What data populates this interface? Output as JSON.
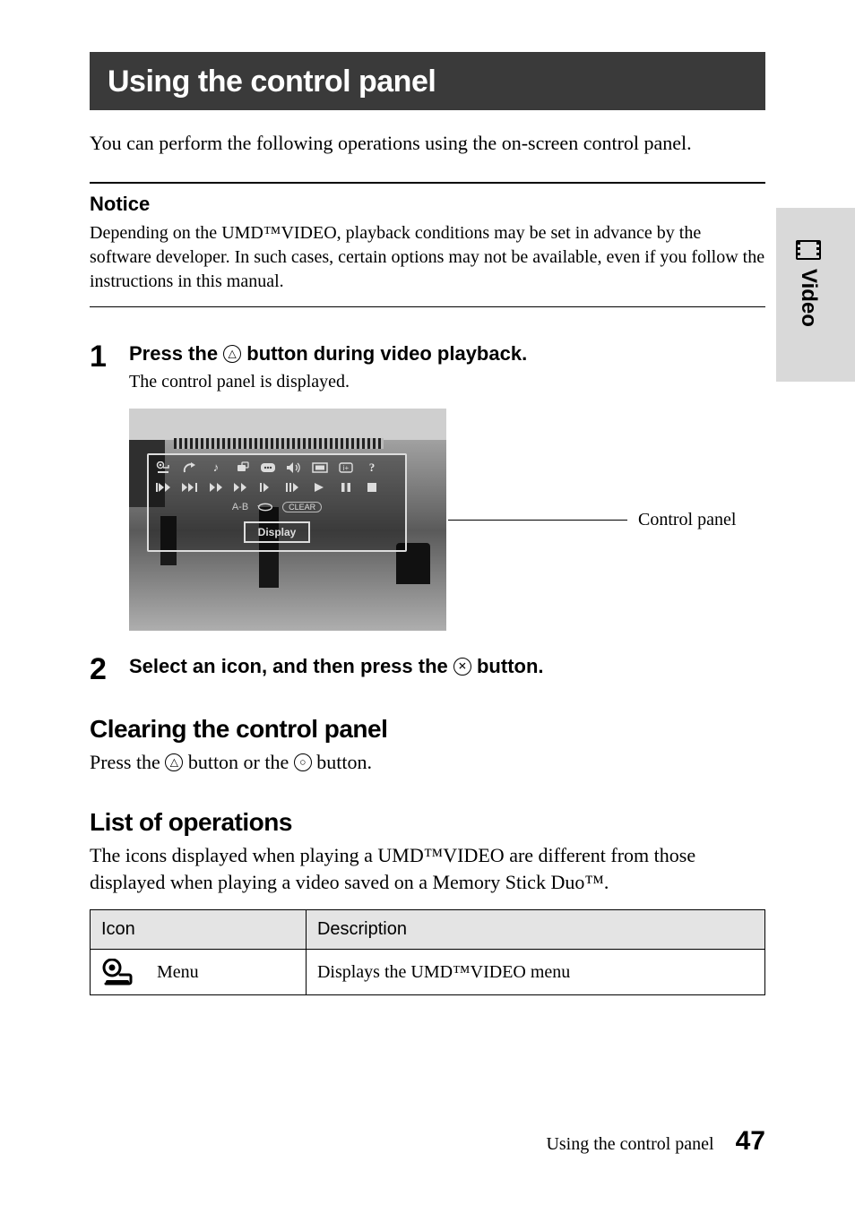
{
  "title_bar": "Using the control panel",
  "intro": "You can perform the following operations using the on-screen control panel.",
  "notice": {
    "heading": "Notice",
    "body": "Depending on the UMD™VIDEO, playback conditions may be set in advance by the software developer. In such cases, certain options may not be available, even if you follow the instructions in this manual."
  },
  "steps": {
    "s1": {
      "num": "1",
      "pre": "Press the ",
      "post": " button during video playback.",
      "button_glyph": "△",
      "sub": "The control panel is displayed."
    },
    "s2": {
      "num": "2",
      "pre": "Select an icon, and then press the ",
      "post": " button.",
      "button_glyph": "✕"
    }
  },
  "figure": {
    "callout_label": "Control panel",
    "overlay": {
      "ab": "A-B",
      "clear_btn": "CLEAR",
      "display_btn": "Display"
    }
  },
  "clearing": {
    "heading": "Clearing the control panel",
    "pre": "Press the ",
    "mid": " button or the ",
    "post": " button.",
    "btn1_glyph": "△",
    "btn2_glyph": "○"
  },
  "operations": {
    "heading": "List of operations",
    "intro": "The icons displayed when playing a UMD™VIDEO are different from those displayed when playing a video saved on a Memory Stick Duo™.",
    "table": {
      "h_icon": "Icon",
      "h_desc": "Description",
      "row1": {
        "label": "Menu",
        "desc": "Displays the UMD™VIDEO menu"
      }
    }
  },
  "side_tab_label": "Video",
  "footer": {
    "title": "Using the control panel",
    "page": "47"
  }
}
